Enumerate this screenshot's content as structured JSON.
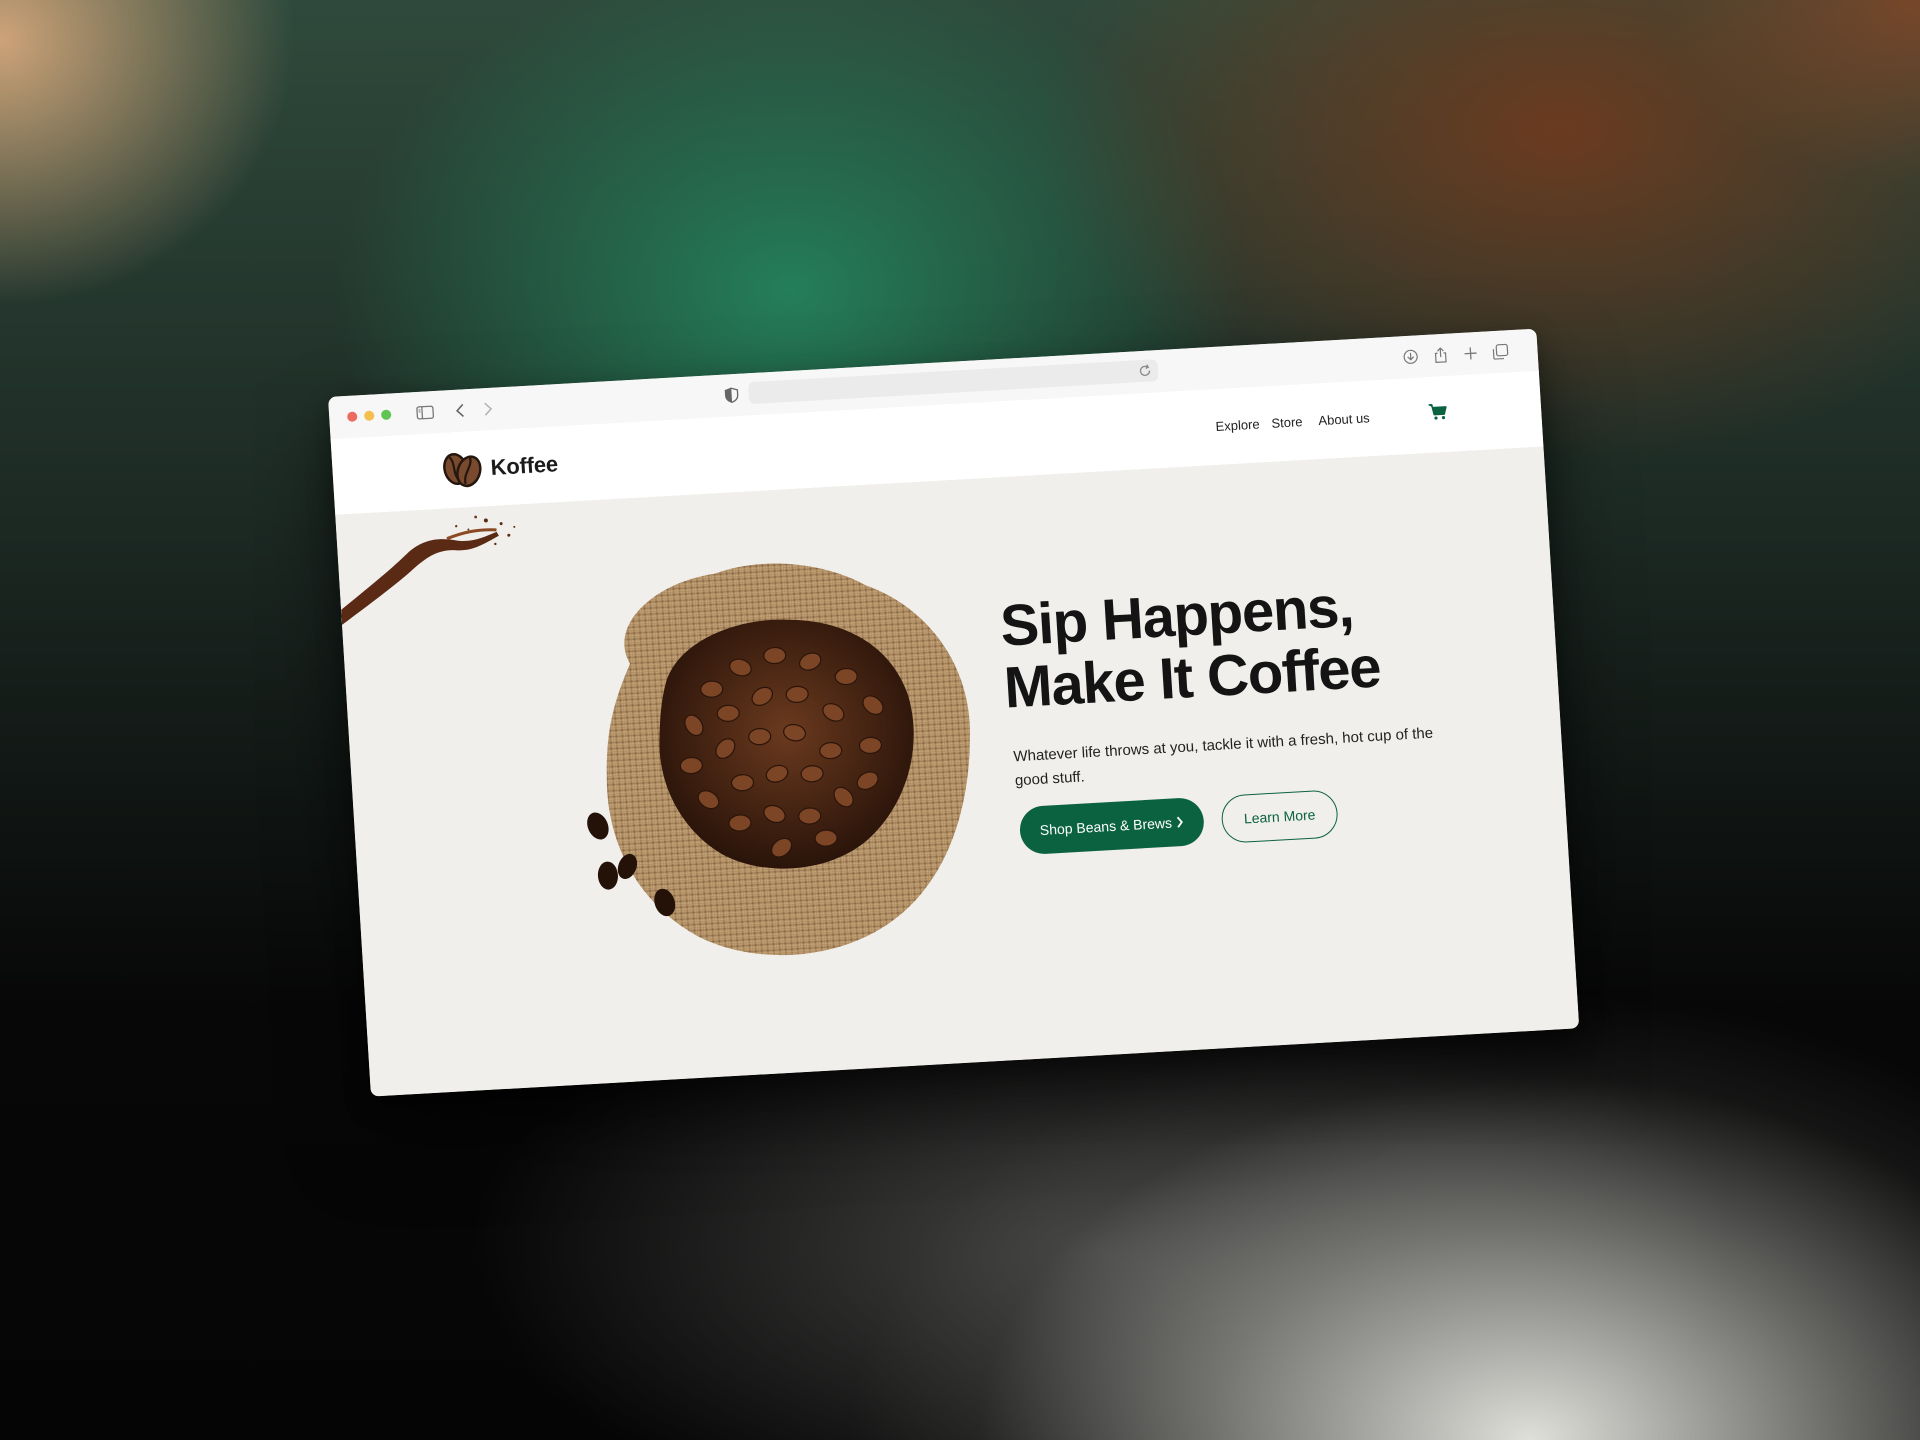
{
  "brand": {
    "name": "Koffee",
    "logo_icon": "coffee-beans-icon"
  },
  "nav": {
    "links": [
      "Explore",
      "Store",
      "About us"
    ],
    "cart_icon": "cart-icon"
  },
  "hero": {
    "headline_line1": "Sip Happens,",
    "headline_line2": "Make It Coffee",
    "subtext_line1": "Whatever life throws at you, tackle it with a fresh, hot cup of the",
    "subtext_line2": "good stuff.",
    "primary_button": "Shop Beans & Brews",
    "secondary_button": "Learn More",
    "image": "burlap-sack-of-coffee-beans"
  },
  "colors": {
    "accent": "#0b6241",
    "page_background": "#f1efeb",
    "navbar_background": "#ffffff"
  }
}
